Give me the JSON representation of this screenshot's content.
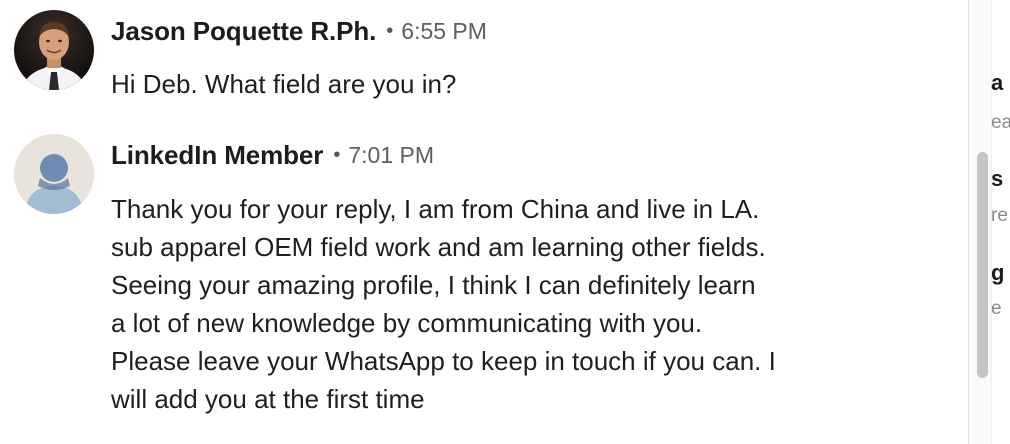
{
  "messages": [
    {
      "sender": "Jason Poquette R.Ph.",
      "separator": "•",
      "time": "6:55 PM",
      "avatar_icon": "profile-photo",
      "lines": [
        "Hi Deb. What field are you in?"
      ]
    },
    {
      "sender": "LinkedIn Member",
      "separator": "•",
      "time": "7:01 PM",
      "avatar_icon": "default-person-icon",
      "lines": [
        "Thank you for your reply, I am from China and live in LA.",
        "sub apparel OEM field work and am learning other fields.",
        "Seeing your amazing profile, I think I can definitely learn",
        "a lot of new knowledge by communicating with you.",
        "Please leave your WhatsApp to keep in touch if you can. I",
        "will add you at the first time"
      ]
    }
  ],
  "side_panel": {
    "fragments": [
      "a",
      "ea",
      "s",
      "re",
      "g",
      "e"
    ]
  },
  "colors": {
    "text": "#1f1f1f",
    "muted": "#5e5e5e",
    "default_avatar_bg": "#e8e3dc",
    "default_avatar_fg": "#7895b5",
    "scrollbar_thumb": "#c4c4c4"
  }
}
